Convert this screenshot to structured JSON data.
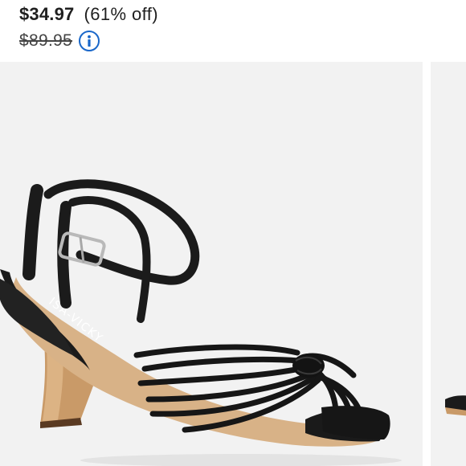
{
  "product": {
    "sale_price": "$34.97",
    "discount": "(61% off)",
    "original_price": "$89.95"
  },
  "icons": {
    "info": "info-circle-icon"
  },
  "images": {
    "main_alt": "Black knotted strappy sandal with ankle strap and flared heel",
    "brand_imprint": "ISA-VICKY"
  },
  "colors": {
    "sale_text": "#1f1f1f",
    "info_accent": "#1a67c9",
    "image_background": "#f2f2f2"
  }
}
